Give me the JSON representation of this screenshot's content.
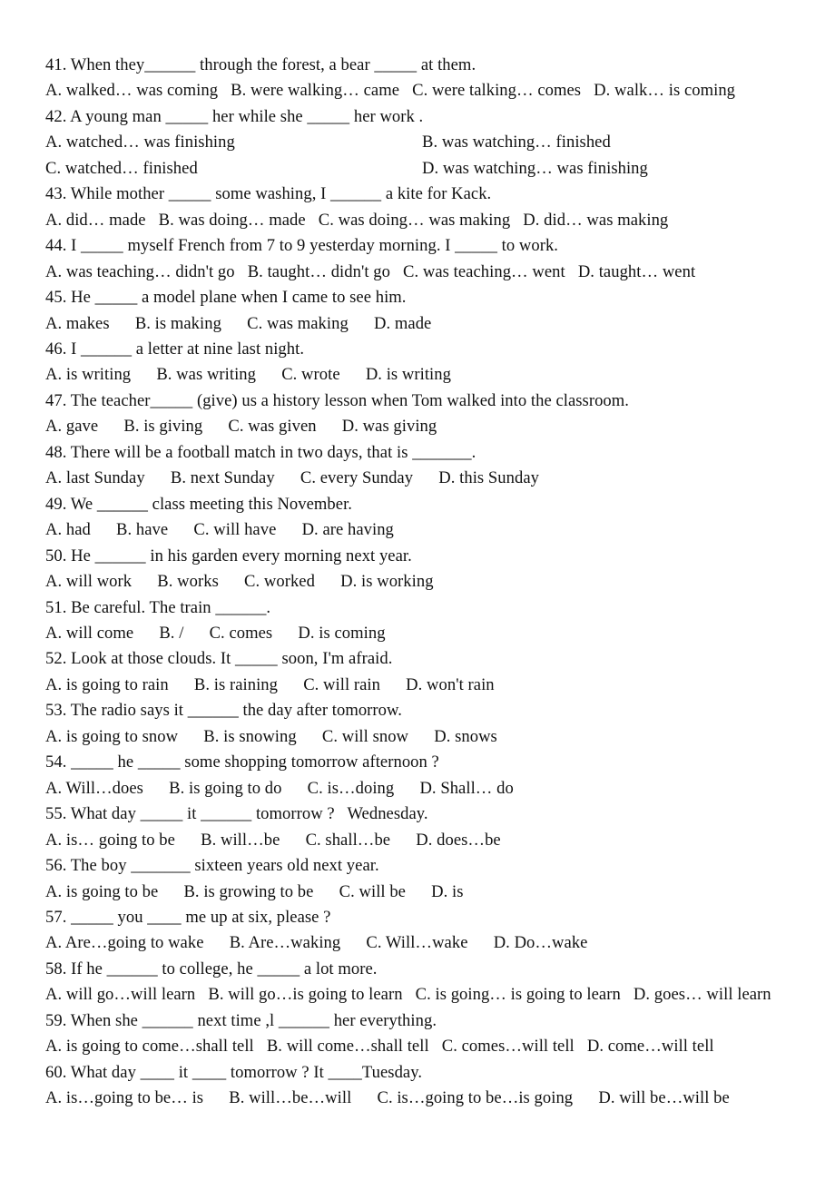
{
  "document": {
    "type": "grammar-multiple-choice-worksheet",
    "first_item_number": 41,
    "last_item_number": 60
  },
  "items": [
    {
      "number": "41",
      "question": "41. When they______ through the forest, a bear _____ at them.",
      "options_layout": "single-line",
      "options_line": "A. walked… was coming   B. were walking… came   C. were talking… comes   D. walk… is coming",
      "options": [
        "A. walked… was coming",
        "B. were walking… came",
        "C. were talking… comes",
        "D. walk… is coming"
      ]
    },
    {
      "number": "42",
      "question": "42. A young man _____ her while she _____ her work .",
      "options_layout": "two-column",
      "options_row1_left": "A. watched… was finishing",
      "options_row1_right": "B. was watching… finished",
      "options_row2_left": "C. watched… finished",
      "options_row2_right": "D. was watching… was finishing",
      "options": [
        "A. watched… was finishing",
        "B. was watching… finished",
        "C. watched… finished",
        "D. was watching… was finishing"
      ]
    },
    {
      "number": "43",
      "question": "43. While mother _____ some washing, I ______ a kite for Kack.",
      "options_layout": "single-line",
      "options_line": "A. did… made   B. was doing… made   C. was doing… was making   D. did… was making",
      "options": [
        "A. did… made",
        "B. was doing… made",
        "C. was doing… was making",
        "D. did… was making"
      ]
    },
    {
      "number": "44",
      "question": "44. I _____ myself French from 7 to 9 yesterday morning. I _____ to work.",
      "options_layout": "single-line",
      "options_line": "A. was teaching… didn't go   B. taught… didn't go   C. was teaching… went   D. taught… went",
      "options": [
        "A. was teaching… didn't go",
        "B. taught… didn't go",
        "C. was teaching… went",
        "D. taught… went"
      ]
    },
    {
      "number": "45",
      "question": "45. He _____ a model plane when I came to see him.",
      "options_layout": "single-line",
      "options_line": "A. makes      B. is making      C. was making      D. made",
      "options": [
        "A. makes",
        "B. is making",
        "C. was making",
        "D. made"
      ]
    },
    {
      "number": "46",
      "question": "46. I ______ a letter at nine last night.",
      "options_layout": "single-line",
      "options_line": "A. is writing      B. was writing      C. wrote      D. is writing",
      "options": [
        "A. is writing",
        "B. was writing",
        "C. wrote",
        "D. is writing"
      ]
    },
    {
      "number": "47",
      "question": "47. The teacher_____ (give) us a history lesson when Tom walked into the classroom.",
      "options_layout": "single-line",
      "options_line": "A. gave      B. is giving      C. was given      D. was giving",
      "options": [
        "A. gave",
        "B. is giving",
        "C. was given",
        "D. was giving"
      ]
    },
    {
      "number": "48",
      "question": "48. There will be a football match in two days, that is _______.",
      "options_layout": "single-line",
      "options_line": "A. last Sunday      B. next Sunday      C. every Sunday      D. this Sunday",
      "options": [
        "A. last Sunday",
        "B. next Sunday",
        "C. every Sunday",
        "D. this Sunday"
      ]
    },
    {
      "number": "49",
      "question": "49. We ______ class meeting this November.",
      "options_layout": "single-line",
      "options_line": "A. had      B. have      C. will have      D. are having",
      "options": [
        "A. had",
        "B. have",
        "C. will have",
        "D. are having"
      ]
    },
    {
      "number": "50",
      "question": "50. He ______ in his garden every morning next year.",
      "options_layout": "single-line",
      "options_line": "A. will work      B. works      C. worked      D. is working",
      "options": [
        "A. will work",
        "B. works",
        "C. worked",
        "D. is working"
      ]
    },
    {
      "number": "51",
      "question": "51. Be careful. The train ______.",
      "options_layout": "single-line",
      "options_line": "A. will come      B. /      C. comes      D. is coming",
      "options": [
        "A. will come",
        "B. /",
        "C. comes",
        "D. is coming"
      ]
    },
    {
      "number": "52",
      "question": "52. Look at those clouds. It _____ soon, I'm afraid.",
      "options_layout": "single-line",
      "options_line": "A. is going to rain      B. is raining      C. will rain      D. won't rain",
      "options": [
        "A. is going to rain",
        "B. is raining",
        "C. will rain",
        "D. won't rain"
      ]
    },
    {
      "number": "53",
      "question": "53. The radio says it ______ the day after tomorrow.",
      "options_layout": "single-line",
      "options_line": "A. is going to snow      B. is snowing      C. will snow      D. snows",
      "options": [
        "A. is going to snow",
        "B. is snowing",
        "C. will snow",
        "D. snows"
      ]
    },
    {
      "number": "54",
      "question": "54. _____ he _____ some shopping tomorrow afternoon ?",
      "options_layout": "single-line",
      "options_line": "A. Will…does      B. is going to do      C. is…doing      D. Shall… do",
      "options": [
        "A. Will…does",
        "B. is going to do",
        "C. is…doing",
        "D. Shall… do"
      ]
    },
    {
      "number": "55",
      "question": "55. What day _____ it ______ tomorrow ?   Wednesday.",
      "options_layout": "single-line",
      "options_line": "A. is… going to be      B. will…be      C. shall…be      D. does…be",
      "options": [
        "A. is… going to be",
        "B. will…be",
        "C. shall…be",
        "D. does…be"
      ]
    },
    {
      "number": "56",
      "question": "56. The boy _______ sixteen years old next year.",
      "options_layout": "single-line",
      "options_line": "A. is going to be      B. is growing to be      C. will be      D. is",
      "options": [
        "A. is going to be",
        "B. is growing to be",
        "C. will be",
        "D. is"
      ]
    },
    {
      "number": "57",
      "question": "57. _____ you ____ me up at six, please ?",
      "options_layout": "single-line",
      "options_line": "A. Are…going to wake      B. Are…waking      C. Will…wake      D. Do…wake",
      "options": [
        "A. Are…going to wake",
        "B. Are…waking",
        "C. Will…wake",
        "D. Do…wake"
      ]
    },
    {
      "number": "58",
      "question": "58. If he ______ to college, he _____ a lot more.",
      "options_layout": "single-line",
      "options_line": "A. will go…will learn   B. will go…is going to learn   C. is going… is going to learn   D. goes… will learn",
      "options": [
        "A. will go…will learn",
        "B. will go…is going to learn",
        "C. is going… is going to learn",
        "D. goes… will learn"
      ]
    },
    {
      "number": "59",
      "question": "59. When she ______ next time ,l ______ her everything.",
      "options_layout": "single-line",
      "options_line": "A. is going to come…shall tell   B. will come…shall tell   C. comes…will tell   D. come…will tell",
      "options": [
        "A. is going to come…shall tell",
        "B. will come…shall tell",
        "C. comes…will tell",
        "D. come…will tell"
      ]
    },
    {
      "number": "60",
      "question": "60. What day ____ it ____ tomorrow ? It ____Tuesday.",
      "options_layout": "single-line",
      "options_line": "A. is…going to be… is      B. will…be…will      C. is…going to be…is going      D. will be…will be",
      "options": [
        "A. is…going to be… is",
        "B. will…be…will",
        "C. is…going to be…is going",
        "D. will be…will be"
      ]
    }
  ]
}
